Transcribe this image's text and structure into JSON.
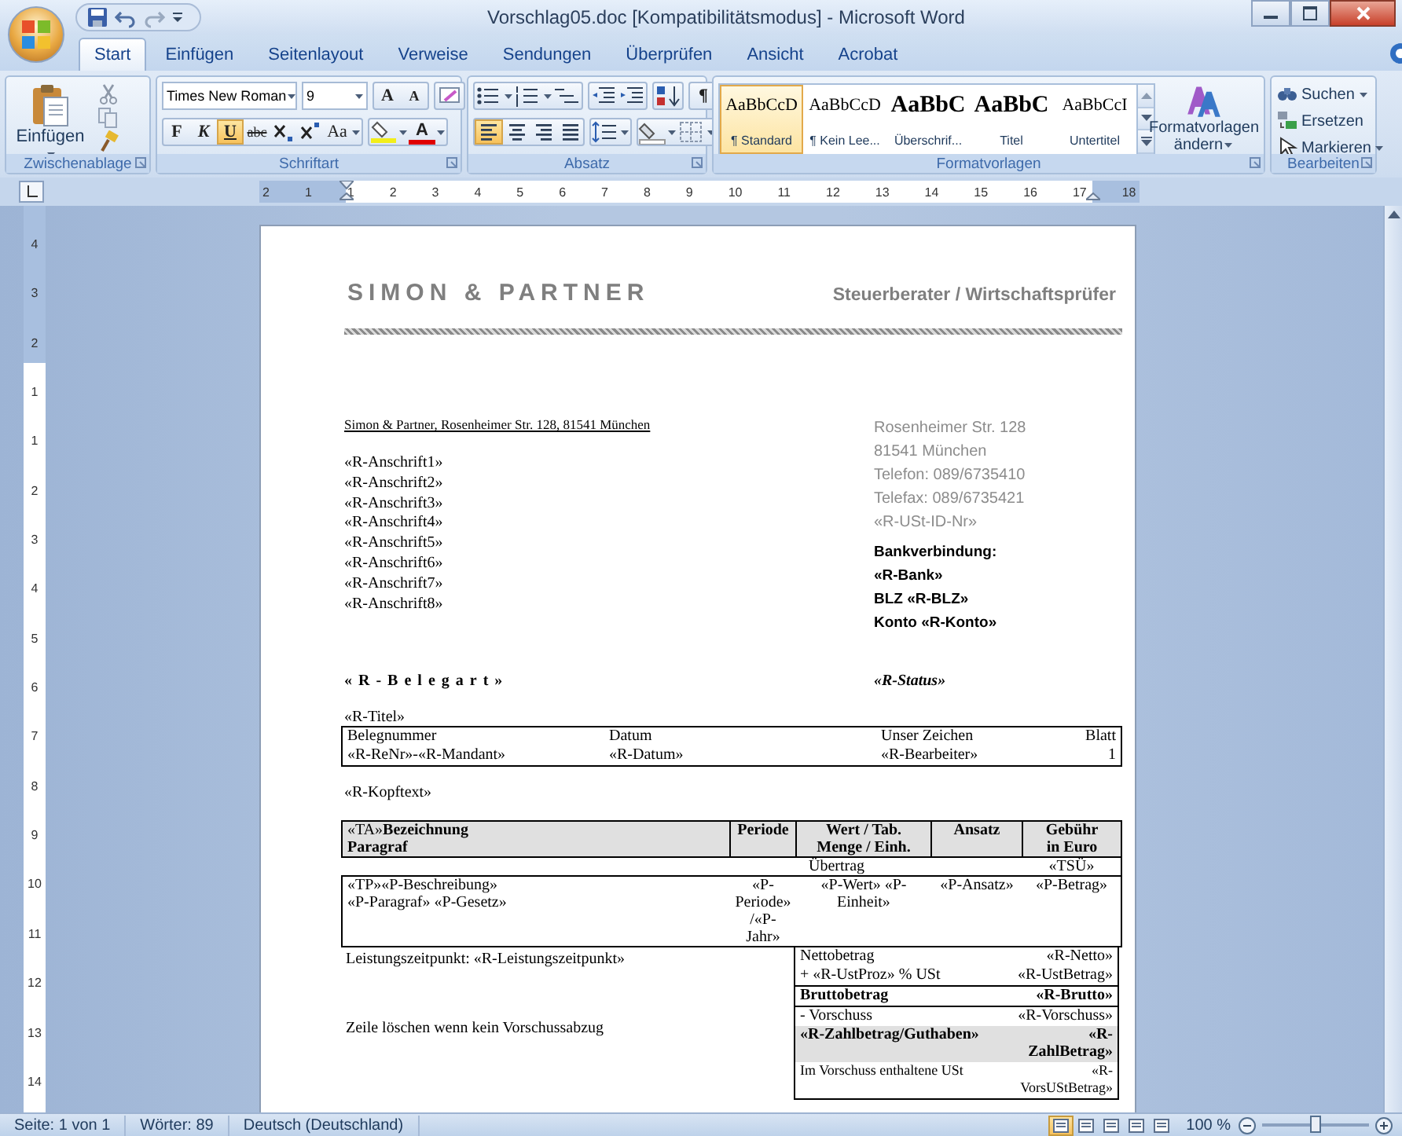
{
  "window": {
    "title": "Vorschlag05.doc [Kompatibilitätsmodus] - Microsoft Word"
  },
  "tabs": [
    {
      "label": "Start",
      "selected": true
    },
    {
      "label": "Einfügen",
      "selected": false
    },
    {
      "label": "Seitenlayout",
      "selected": false
    },
    {
      "label": "Verweise",
      "selected": false
    },
    {
      "label": "Sendungen",
      "selected": false
    },
    {
      "label": "Überprüfen",
      "selected": false
    },
    {
      "label": "Ansicht",
      "selected": false
    },
    {
      "label": "Acrobat",
      "selected": false
    }
  ],
  "ribbon": {
    "clipboard": {
      "paste": "Einfügen",
      "label": "Zwischenablage"
    },
    "font": {
      "name": "Times New Roman",
      "size": "9",
      "grow": "A",
      "shrink": "A",
      "format_buttons": [
        {
          "label": "F",
          "kind": "bold",
          "on": false
        },
        {
          "label": "K",
          "kind": "italic",
          "on": false
        },
        {
          "label": "U",
          "kind": "underline",
          "on": true
        },
        {
          "label": "abc",
          "kind": "strike",
          "on": false
        }
      ],
      "case": "Aa",
      "color_button": "A",
      "label": "Schriftart"
    },
    "paragraph": {
      "alignment": [
        {
          "kind": "left",
          "selected": true
        },
        {
          "kind": "center",
          "selected": false
        },
        {
          "kind": "right",
          "selected": false
        },
        {
          "kind": "justify",
          "selected": false
        }
      ],
      "marks": "¶",
      "label": "Absatz"
    },
    "styles": {
      "items": [
        {
          "preview": "AaBbCcD",
          "name": "¶ Standard",
          "kind": "normal",
          "selected": true
        },
        {
          "preview": "AaBbCcD",
          "name": "¶ Kein Lee...",
          "kind": "normal",
          "selected": false
        },
        {
          "preview": "AaBbC",
          "name": "Überschrif...",
          "kind": "heading",
          "selected": false
        },
        {
          "preview": "AaBbC",
          "name": "Titel",
          "kind": "heading",
          "selected": false
        },
        {
          "preview": "AaBbCcI",
          "name": "Untertitel",
          "kind": "normal",
          "selected": false
        }
      ],
      "change": "Formatvorlagen ändern",
      "label": "Formatvorlagen"
    },
    "editing": {
      "items": [
        {
          "label": "Suchen",
          "kind": "find"
        },
        {
          "label": "Ersetzen",
          "kind": "replace"
        },
        {
          "label": "Markieren",
          "kind": "select"
        }
      ],
      "label": "Bearbeiten"
    }
  },
  "ruler": {
    "horizontal": [
      "2",
      "1",
      "1",
      "2",
      "3",
      "4",
      "5",
      "6",
      "7",
      "8",
      "9",
      "10",
      "11",
      "12",
      "13",
      "14",
      "15",
      "16",
      "17",
      "18"
    ],
    "vertical": [
      "4",
      "3",
      "2",
      "1",
      "1",
      "2",
      "3",
      "4",
      "5",
      "6",
      "7",
      "8",
      "9",
      "10",
      "11",
      "12",
      "13",
      "14"
    ]
  },
  "document": {
    "company": "SIMON & PARTNER",
    "tagline": "Steuerberater / Wirtschaftsprüfer",
    "sender_line": "Simon & Partner, Rosenheimer Str. 128, 81541 München",
    "address_lines": [
      "«R-Anschrift1»",
      "«R-Anschrift2»",
      "«R-Anschrift3»",
      "«R-Anschrift4»",
      "«R-Anschrift5»",
      "«R-Anschrift6»",
      "«R-Anschrift7»",
      "«R-Anschrift8»"
    ],
    "contact_lines": [
      "Rosenheimer Str. 128",
      "81541 München",
      "Telefon: 089/6735410",
      "Telefax: 089/6735421",
      "«R-USt-ID-Nr»"
    ],
    "bank_lines": [
      "Bankverbindung:",
      "«R-Bank»",
      "BLZ  «R-BLZ»",
      "Konto  «R-Konto»"
    ],
    "document_type": "«R-Belegart»",
    "status": "«R-Status»",
    "title": "«R-Titel»",
    "reference_table": {
      "columns": [
        "Belegnummer",
        "Datum",
        "Unser Zeichen",
        "Blatt"
      ],
      "values": [
        "«R-ReNr»-«R-Mandant»",
        "«R-Datum»",
        "«R-Bearbeiter»",
        "1"
      ]
    },
    "header_text": "«R-Kopftext»",
    "items_table": {
      "columns": [
        "«TA»**Bezeichnung**\n**Paragraf**",
        "Periode",
        "Wert / Tab.\nMenge / Einh.",
        "Ansatz",
        "Gebühr\nin Euro"
      ],
      "rows": [
        {
          "kind": "carry",
          "label": "Übertrag",
          "amount": "«TSÜ»"
        },
        {
          "kind": "item",
          "cells": [
            "«TP»«P-Beschreibung»\n«P-Paragraf» «P-Gesetz»",
            "«P-Periode» /«P-Jahr»",
            "«P-Wert» «P-Einheit»",
            "«P-Ansatz»",
            "«P-Betrag»"
          ]
        }
      ]
    },
    "notes": [
      "Leistungszeitpunkt: «R-Leistungszeitpunkt»",
      "Zeile löschen wenn kein Vorschussabzug"
    ],
    "totals": [
      {
        "label": "Nettobetrag",
        "value": "«R-Netto»",
        "kind": "normal"
      },
      {
        "label": "+   «R-UstProz» % USt",
        "value": "«R-UstBetrag»",
        "kind": "normal"
      },
      {
        "label": "Bruttobetrag",
        "value": "«R-Brutto»",
        "kind": "total"
      },
      {
        "label": "- Vorschuss",
        "value": "«R-Vorschuss»",
        "kind": "normal"
      },
      {
        "label": "«R-Zahlbetrag/Guthaben»",
        "value": "«R-ZahlBetrag»",
        "kind": "due"
      },
      {
        "label": "Im Vorschuss enthaltene  USt",
        "value": "«R-VorsUStBetrag»",
        "kind": "small"
      }
    ]
  },
  "status_bar": {
    "page": "Seite: 1 von 1",
    "words": "Wörter: 89",
    "language": "Deutsch (Deutschland)",
    "views": [
      {
        "selected": true
      },
      {
        "selected": false
      },
      {
        "selected": false
      },
      {
        "selected": false
      },
      {
        "selected": false
      }
    ],
    "zoom": {
      "label": "100 %",
      "level": 0.5
    }
  }
}
